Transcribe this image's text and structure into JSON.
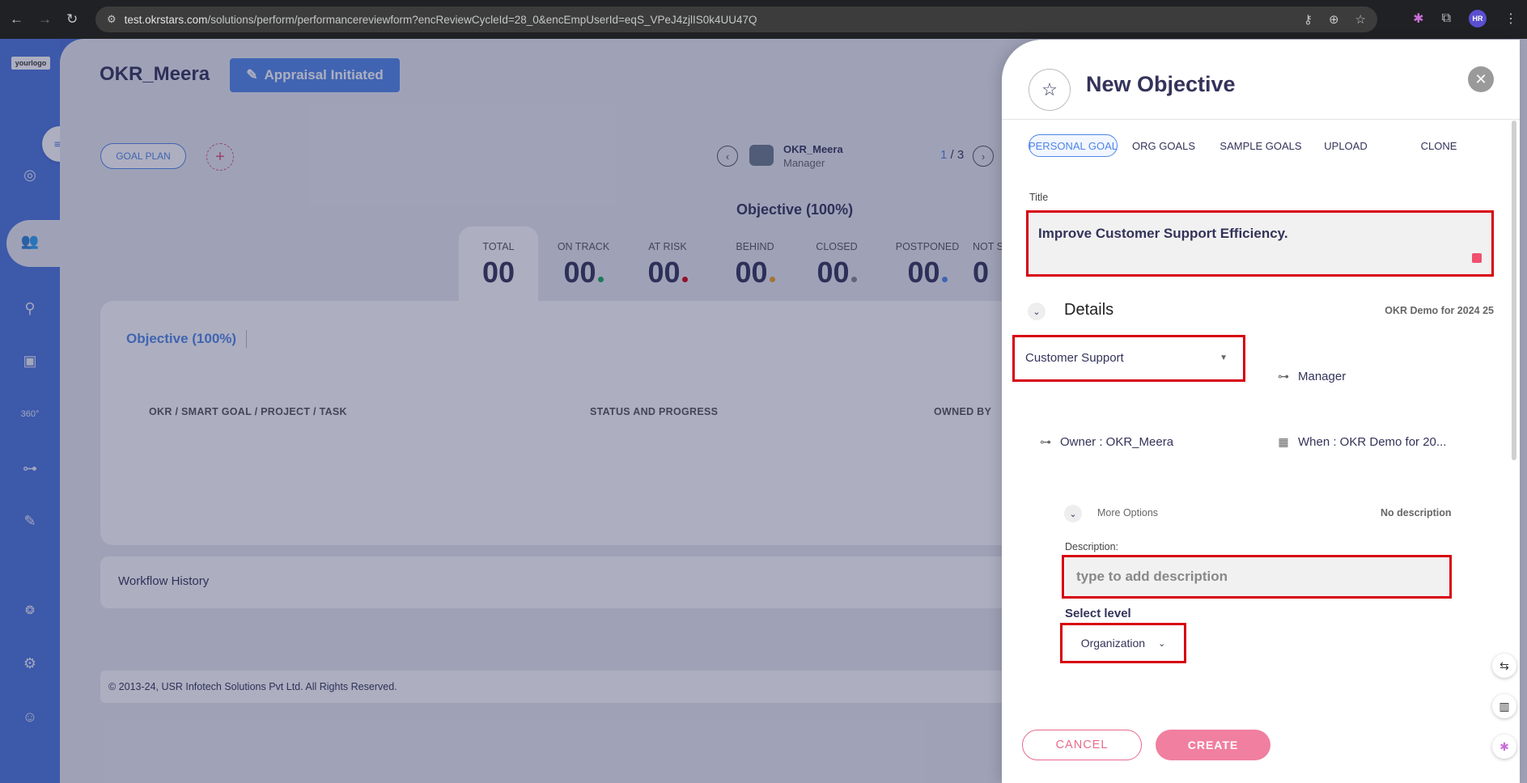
{
  "browser": {
    "url_host": "test.okrstars.com",
    "url_path": "/solutions/perform/performancereviewform?encReviewCycleId=28_0&encEmpUserId=eqS_VPeJ4zjlIS0k4UU47Q"
  },
  "sidebar": {
    "logo_text": "yourlogo",
    "icons": [
      "target-icon",
      "team-icon",
      "person-tree-icon",
      "book-icon",
      "360-icon",
      "hierarchy-icon",
      "form-icon",
      "brain-icon",
      "settings-icon",
      "support-icon"
    ]
  },
  "header": {
    "title": "OKR_Meera",
    "status_badge": "Appraisal Initiated",
    "goal_plan_button": "GOAL PLAN",
    "add_icon": "+"
  },
  "employee": {
    "name": "OKR_Meera",
    "role": "Manager",
    "page_current": "1",
    "page_total": "/ 3"
  },
  "stats": {
    "heading": "Objective (100%)",
    "items": [
      {
        "label": "TOTAL",
        "value": "00",
        "dot": ""
      },
      {
        "label": "ON TRACK",
        "value": "00",
        "dot": "#1aa860"
      },
      {
        "label": "AT RISK",
        "value": "00",
        "dot": "#d7000f"
      },
      {
        "label": "BEHIND",
        "value": "00",
        "dot": "#f0a020"
      },
      {
        "label": "CLOSED",
        "value": "00",
        "dot": "#888888"
      },
      {
        "label": "POSTPONED",
        "value": "00",
        "dot": "#4f86e8"
      },
      {
        "label": "NOT S",
        "value": "0",
        "dot": ""
      }
    ]
  },
  "table": {
    "tab_label": "Objective (100%)",
    "columns": [
      "OKR / SMART GOAL / PROJECT / TASK",
      "STATUS AND PROGRESS",
      "OWNED BY"
    ]
  },
  "workflow_label": "Workflow History",
  "footer_text": "© 2013-24, USR Infotech Solutions Pvt Ltd. All Rights Reserved.",
  "drawer": {
    "title": "New Objective",
    "tabs": [
      "PERSONAL GOAL",
      "ORG GOALS",
      "SAMPLE GOALS",
      "UPLOAD",
      "CLONE"
    ],
    "title_label": "Title",
    "title_value": "Improve Customer Support Efficiency.",
    "details_heading": "Details",
    "details_meta": "OKR Demo for 2024 25",
    "department_value": "Customer Support",
    "manager_label": "Manager",
    "owner_label": "Owner : OKR_Meera",
    "when_label": "When : OKR Demo for 20...",
    "more_options_label": "More Options",
    "no_description": "No description",
    "description_label": "Description:",
    "description_placeholder": "type to add description",
    "level_label": "Select level",
    "level_value": "Organization",
    "cancel_label": "CANCEL",
    "create_label": "CREATE"
  },
  "colors": {
    "accent": "#4f86e8",
    "sidebar": "#4b74dc",
    "highlight": "#d7000f",
    "pink": "#f07fa0"
  }
}
